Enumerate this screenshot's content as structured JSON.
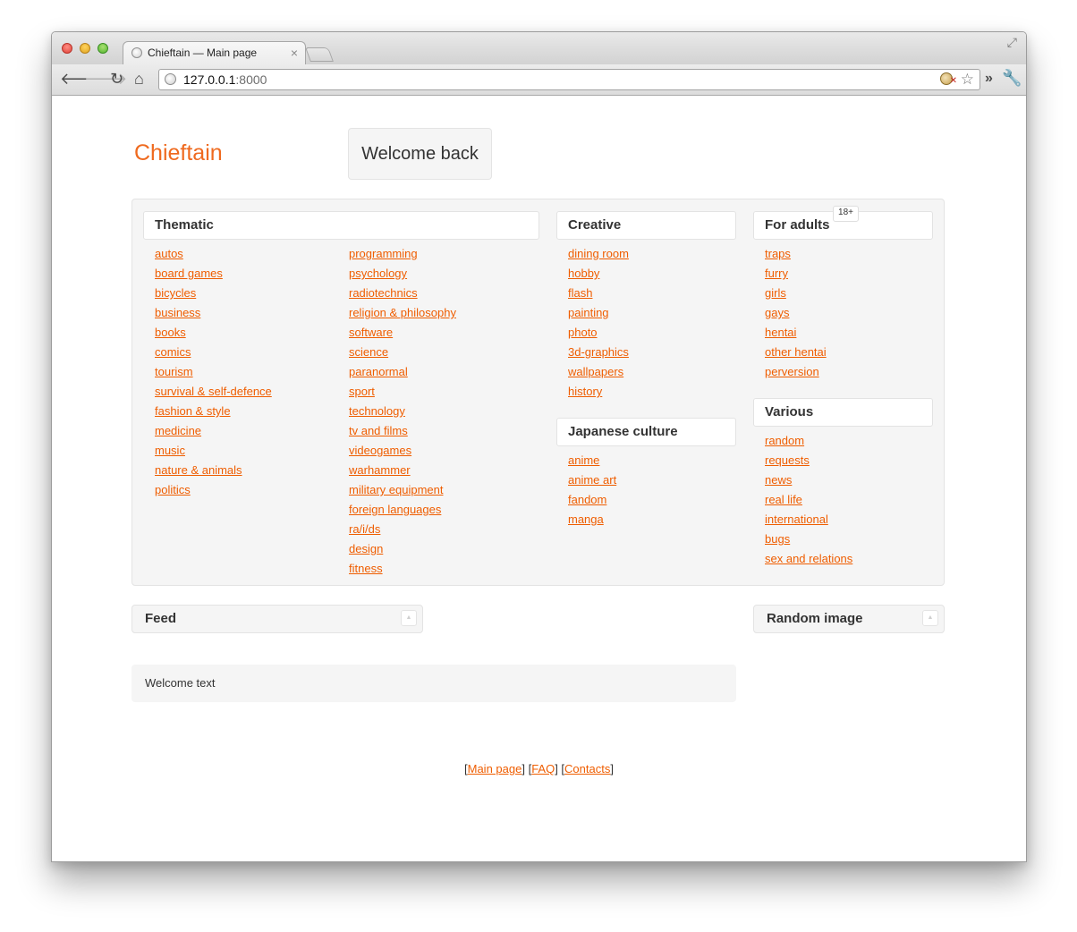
{
  "browser": {
    "tab_title": "Chieftain — Main page",
    "tab_close": "×",
    "url_host": "127.0.0.1",
    "url_port": ":8000",
    "icons": [
      "close-light",
      "minimize-light",
      "maximize-light",
      "back-arrow-icon",
      "forward-arrow-icon",
      "reload-icon",
      "home-icon",
      "globe-icon",
      "extension-icon",
      "star-icon",
      "chevron-icon",
      "wrench-icon",
      "fullscreen-icon"
    ]
  },
  "site": {
    "logo": "Chieftain",
    "welcome": "Welcome back"
  },
  "thematic": {
    "title": "Thematic",
    "col1": [
      "autos",
      "board games",
      "bicycles",
      "business",
      "books",
      "comics",
      "tourism",
      "survival & self-defence",
      "fashion & style",
      "medicine",
      "music",
      "nature & animals",
      "politics"
    ],
    "col2": [
      "programming",
      "psychology",
      "radiotechnics",
      "religion & philosophy",
      "software",
      "science",
      "paranormal",
      "sport",
      "technology",
      "tv and films",
      "videogames",
      "warhammer",
      "military equipment",
      "foreign languages",
      "ra/i/ds",
      "design",
      "fitness"
    ]
  },
  "creative": {
    "title": "Creative",
    "items": [
      "dining room",
      "hobby",
      "flash",
      "painting",
      "photo",
      "3d-graphics",
      "wallpapers",
      "history"
    ]
  },
  "japanese": {
    "title": "Japanese culture",
    "items": [
      "anime",
      "anime art",
      "fandom",
      "manga"
    ]
  },
  "adults": {
    "title": "For adults",
    "badge": "18+",
    "items": [
      "traps",
      "furry",
      "girls",
      "gays",
      "hentai",
      "other hentai",
      "perversion"
    ]
  },
  "various": {
    "title": "Various",
    "items": [
      "random",
      "requests",
      "news",
      "real life",
      "international",
      "bugs",
      "sex and relations"
    ]
  },
  "panels": {
    "feed": "Feed",
    "random_image": "Random image",
    "collapse_glyph": "▲"
  },
  "welcome_text": "Welcome text",
  "footer": {
    "links": [
      "Main page",
      "FAQ",
      "Contacts"
    ]
  },
  "colors": {
    "link": "#ef5d00",
    "logo": "#ef6a1f",
    "panel_bg": "#f5f5f5"
  }
}
